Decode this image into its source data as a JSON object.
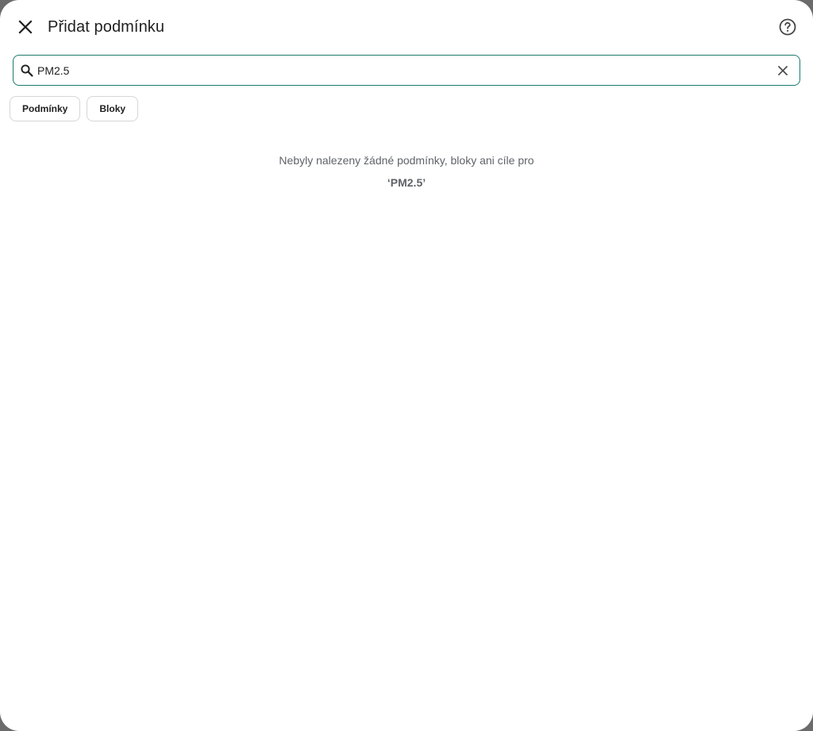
{
  "dialog": {
    "title": "Přidat podmínku",
    "close_icon": "close-icon",
    "help_icon": "help-circle-icon"
  },
  "search": {
    "icon": "search-icon",
    "value": "PM2.5",
    "clear_icon": "clear-icon",
    "accent_color": "#1a7a6e"
  },
  "chips": [
    {
      "label": "Podmínky"
    },
    {
      "label": "Bloky"
    }
  ],
  "empty_state": {
    "message": "Nebyly nalezeny žádné podmínky, bloky ani cíle pro",
    "query": "‘PM2.5’"
  }
}
